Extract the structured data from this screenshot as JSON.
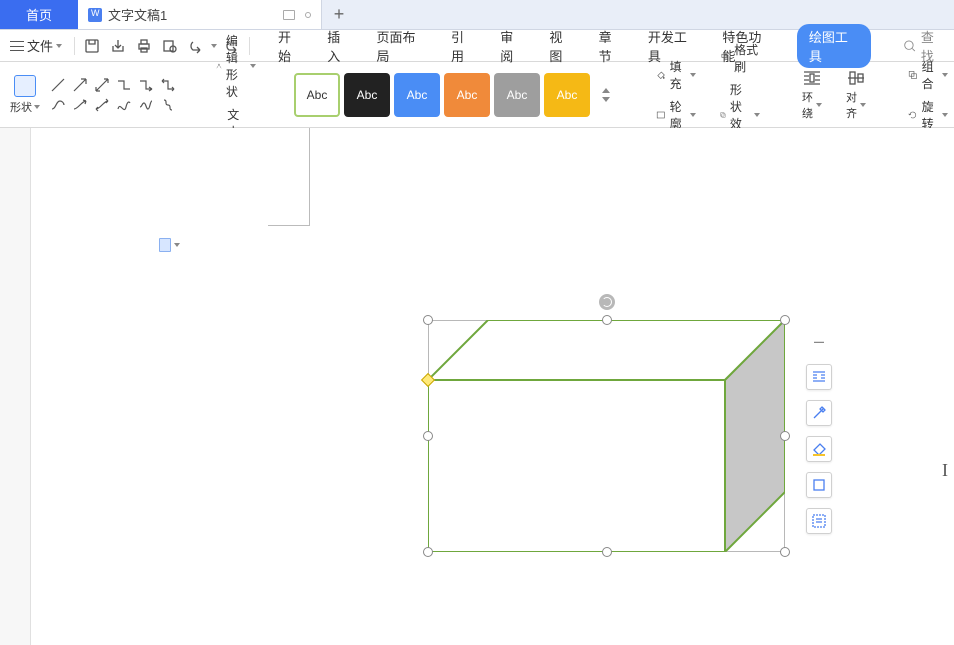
{
  "tabs": {
    "home": "首页",
    "doc": "文字文稿1"
  },
  "file_menu": "文件",
  "menu": [
    "开始",
    "插入",
    "页面布局",
    "引用",
    "审阅",
    "视图",
    "章节",
    "开发工具",
    "特色功能"
  ],
  "menu_draw": "绘图工具",
  "search_placeholder": "查找",
  "ribbon": {
    "shape": "形状",
    "edit_shape": "编辑形状",
    "text_box": "文本框",
    "style_label": "Abc",
    "fill": "填充",
    "outline": "轮廓",
    "format_painter": "格式刷",
    "shape_effect": "形状效果",
    "wrap": "环绕",
    "align": "对齐",
    "group": "组合",
    "rotate": "旋转"
  }
}
